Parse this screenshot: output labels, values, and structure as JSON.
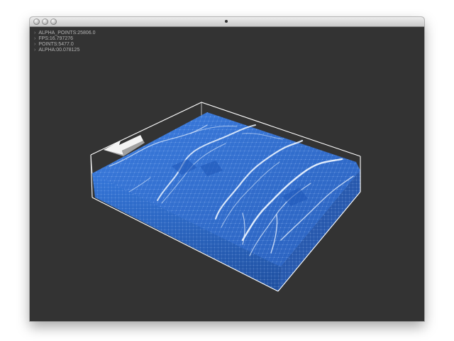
{
  "window": {
    "title_marker": "•"
  },
  "hud": {
    "lines": [
      {
        "mark": "›",
        "text": "ALPHA_POINTS:25806.0"
      },
      {
        "mark": "›",
        "text": "FPS:16.797276"
      },
      {
        "mark": "›",
        "text": "POINTS:5477.0"
      },
      {
        "mark": "›",
        "text": "ALPHA:00.078125"
      }
    ]
  },
  "colors": {
    "background": "#333333",
    "box_outline": "#ffffff",
    "water_fill": "#2f6fd4",
    "water_side": "#2a5fb8",
    "foam": "#e8f2ff",
    "arrow": "#ffffff"
  },
  "scene": {
    "direction_arrow_icon": "left-arrow-icon",
    "simulation": "particle water volume in box"
  }
}
